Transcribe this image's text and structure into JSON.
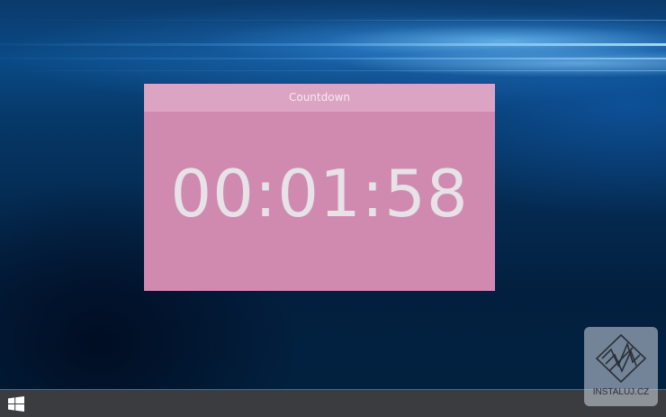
{
  "widget": {
    "title": "Countdown",
    "time": "00:01:58"
  },
  "taskbar": {
    "start_icon": "windows-logo-icon"
  },
  "watermark": {
    "text": "INSTALUJ.CZ"
  },
  "colors": {
    "widget_bg": "#d08aaf",
    "widget_title_bg": "#dba4c2",
    "timer_text": "#e6e2e7",
    "taskbar_bg": "#3a3c3f",
    "desktop_blue": "#04294f"
  }
}
